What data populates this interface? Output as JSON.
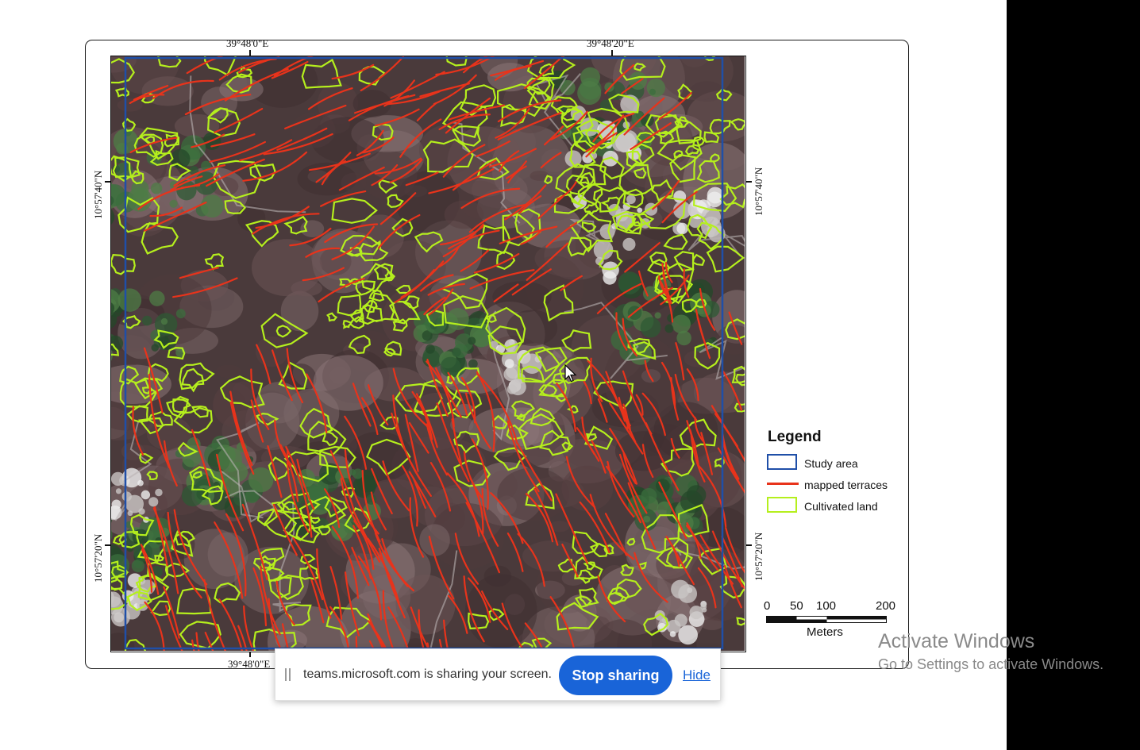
{
  "map": {
    "coords_top": [
      "39°48'0\"E",
      "39°48'20\"E"
    ],
    "coords_bottom": [
      "39°48'0\"E"
    ],
    "coords_left": [
      "10°57'40\"N",
      "10°57'20\"N"
    ],
    "coords_right": [
      "10°57'40\"N",
      "10°57'20\"N"
    ]
  },
  "legend": {
    "title": "Legend",
    "items": [
      {
        "label": "Study area",
        "symbol": "box",
        "color": "#1f4fa8"
      },
      {
        "label": "mapped terraces",
        "symbol": "line",
        "color": "#e8331b"
      },
      {
        "label": "Cultivated land",
        "symbol": "box",
        "color": "#b5ef1d"
      }
    ]
  },
  "scalebar": {
    "ticks": [
      "0",
      "50",
      "100",
      "200"
    ],
    "units": "Meters"
  },
  "colors": {
    "terrace": "#e8331b",
    "cultivated": "#b5ef1d",
    "study_area": "#1f4fa8",
    "primary_button": "#1964d8"
  },
  "watermark": {
    "title": "Activate Windows",
    "subtitle": "Go to Settings to activate Windows."
  },
  "share_bar": {
    "message": "teams.microsoft.com is sharing your screen.",
    "stop_label": "Stop sharing",
    "hide_label": "Hide"
  }
}
